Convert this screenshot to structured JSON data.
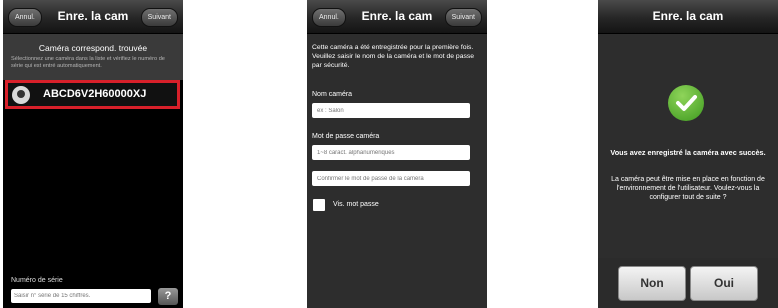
{
  "screen1": {
    "nav": {
      "back": "Annul.",
      "title": "Enre. la cam",
      "next": "Suivant"
    },
    "heading": "Caméra correspond. trouvée",
    "description": "Sélectionnez une caméra dans la liste et vérifiez le numéro de série qui est entré automatiquement.",
    "camera_serial": "ABCD6V2H60000XJ",
    "serial_label": "Numéro de série",
    "serial_placeholder": "Saisir n° série de 15 chiffres.",
    "help": "?"
  },
  "screen2": {
    "nav": {
      "back": "Annul.",
      "title": "Enre. la cam",
      "next": "Suivant"
    },
    "intro": "Cette caméra a été entregistrée pour la première fois. Veuillez saisir le nom de la caméra et le mot de passe par sécurité.",
    "name_label": "Nom caméra",
    "name_placeholder": "ex : Salon",
    "password_label": "Mot de passe caméra",
    "password_placeholder": "1~8 caract. alphanumériques",
    "confirm_placeholder": "Confirmer le mot de passe de la caméra",
    "show_password": "Vis. mot passe"
  },
  "screen3": {
    "nav": {
      "title": "Enre. la cam"
    },
    "success_title": "Vous avez enregistré la caméra avec succès.",
    "success_body": "La caméra peut être mise en place en fonction de l'environnement de l'utilisateur. Voulez-vous la configurer tout de suite ?",
    "no": "Non",
    "yes": "Oui"
  }
}
